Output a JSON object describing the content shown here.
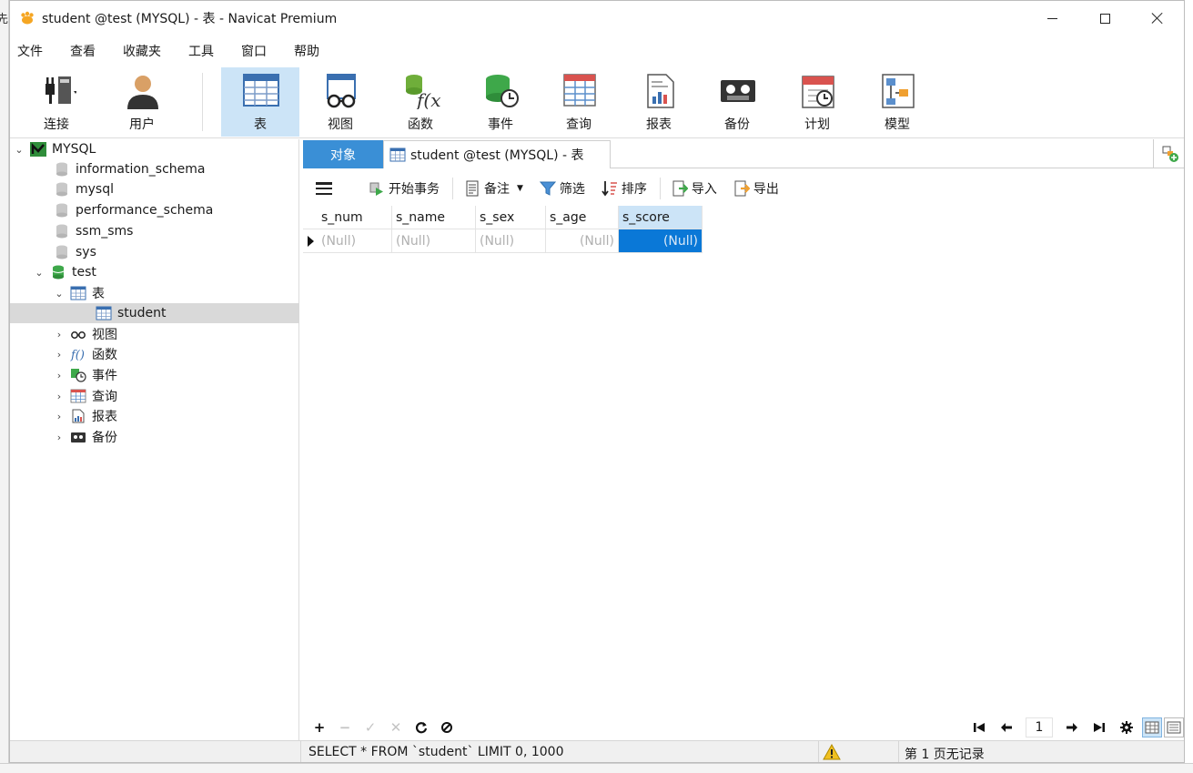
{
  "window": {
    "title": "student @test (MYSQL) - 表 - Navicat Premium"
  },
  "menu": [
    "文件",
    "查看",
    "收藏夹",
    "工具",
    "窗口",
    "帮助"
  ],
  "ribbon": [
    {
      "label": "连接",
      "icon": "plug-icon"
    },
    {
      "label": "用户",
      "icon": "user-icon"
    },
    {
      "label": "表",
      "icon": "table-icon",
      "active": true
    },
    {
      "label": "视图",
      "icon": "glasses-icon"
    },
    {
      "label": "函数",
      "icon": "function-icon"
    },
    {
      "label": "事件",
      "icon": "event-clock-icon"
    },
    {
      "label": "查询",
      "icon": "query-icon"
    },
    {
      "label": "报表",
      "icon": "report-icon"
    },
    {
      "label": "备份",
      "icon": "backup-tape-icon"
    },
    {
      "label": "计划",
      "icon": "schedule-calendar-icon"
    },
    {
      "label": "模型",
      "icon": "model-icon"
    }
  ],
  "tree": {
    "connection": "MYSQL",
    "databases": [
      "information_schema",
      "mysql",
      "performance_schema",
      "ssm_sms",
      "sys"
    ],
    "open_database": "test",
    "tables_group": "表",
    "selected_table": "student",
    "groups": [
      "视图",
      "函数",
      "事件",
      "查询",
      "报表",
      "备份"
    ]
  },
  "tabs": {
    "objects_label": "对象",
    "table_tab_label": "student @test (MYSQL) - 表"
  },
  "toolbar": {
    "begin_transaction": "开始事务",
    "memo": "备注",
    "filter": "筛选",
    "sort": "排序",
    "import": "导入",
    "export": "导出"
  },
  "grid": {
    "columns": [
      "s_num",
      "s_name",
      "s_sex",
      "s_age",
      "s_score"
    ],
    "row": [
      "(Null)",
      "(Null)",
      "(Null)",
      "(Null)",
      "(Null)"
    ],
    "selected_column": "s_score"
  },
  "pager": {
    "page": "1"
  },
  "status": {
    "sql": "SELECT * FROM `student` LIMIT 0, 1000",
    "page_info": "第 1 页无记录"
  },
  "colors": {
    "accent": "#3a8fd6",
    "selection": "#0a78d7",
    "ribbon_active": "#cce4f7"
  }
}
